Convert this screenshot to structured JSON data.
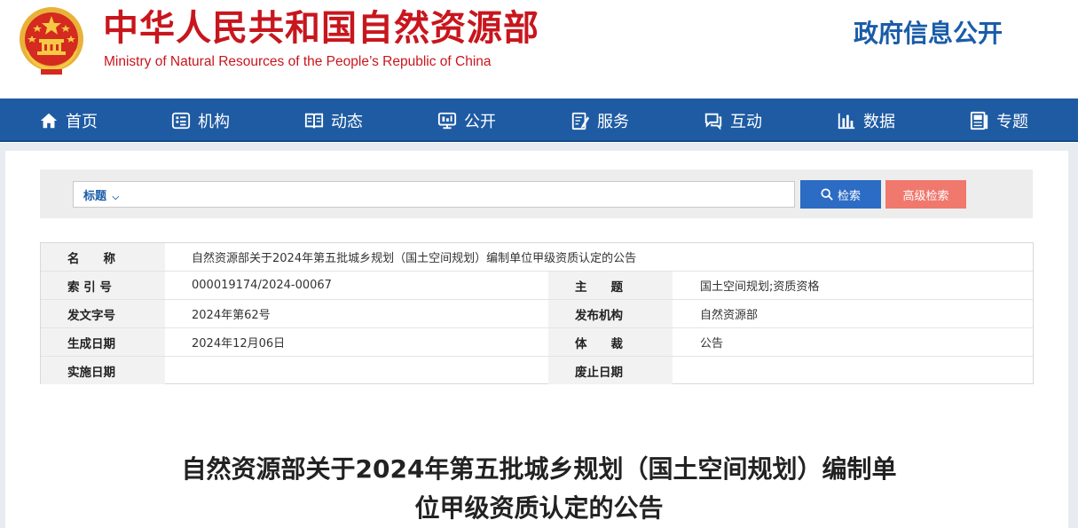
{
  "header": {
    "site_title": "中华人民共和国自然资源部",
    "site_subtitle": "Ministry of Natural Resources of the People’s Republic of China",
    "section_title": "政府信息公开",
    "emblem_icon": "national-emblem-icon",
    "accent_color": "#c8161d"
  },
  "nav": {
    "background_color": "#1e5ba3",
    "items": [
      {
        "label": "首页",
        "icon": "home-icon"
      },
      {
        "label": "机构",
        "icon": "organization-icon"
      },
      {
        "label": "动态",
        "icon": "book-icon"
      },
      {
        "label": "公开",
        "icon": "monitor-icon"
      },
      {
        "label": "服务",
        "icon": "edit-document-icon"
      },
      {
        "label": "互动",
        "icon": "chat-icon"
      },
      {
        "label": "数据",
        "icon": "bar-chart-icon"
      },
      {
        "label": "专题",
        "icon": "topic-document-icon"
      }
    ]
  },
  "search": {
    "type_label": "标题",
    "value": "",
    "search_button_label": "检索",
    "advanced_button_label": "高级检索",
    "search_button_color": "#2c6cc4",
    "advanced_button_color": "#f0786d"
  },
  "meta": {
    "name_label": "名　　称",
    "name_value": "自然资源部关于2024年第五批城乡规划（国土空间规划）编制单位甲级资质认定的公告",
    "index_label": "索 引 号",
    "index_value": "000019174/2024-00067",
    "subject_label": "主　　题",
    "subject_value": "国土空间规划;资质资格",
    "doc_no_label": "发文字号",
    "doc_no_value": "2024年第62号",
    "publisher_label": "发布机构",
    "publisher_value": "自然资源部",
    "date_label": "生成日期",
    "date_value": "2024年12月06日",
    "genre_label": "体　　裁",
    "genre_value": "公告",
    "effective_label": "实施日期",
    "effective_value": "",
    "expire_label": "废止日期",
    "expire_value": ""
  },
  "document": {
    "title": "自然资源部关于2024年第五批城乡规划（国土空间规划）编制单位甲级资质认定的公告"
  }
}
